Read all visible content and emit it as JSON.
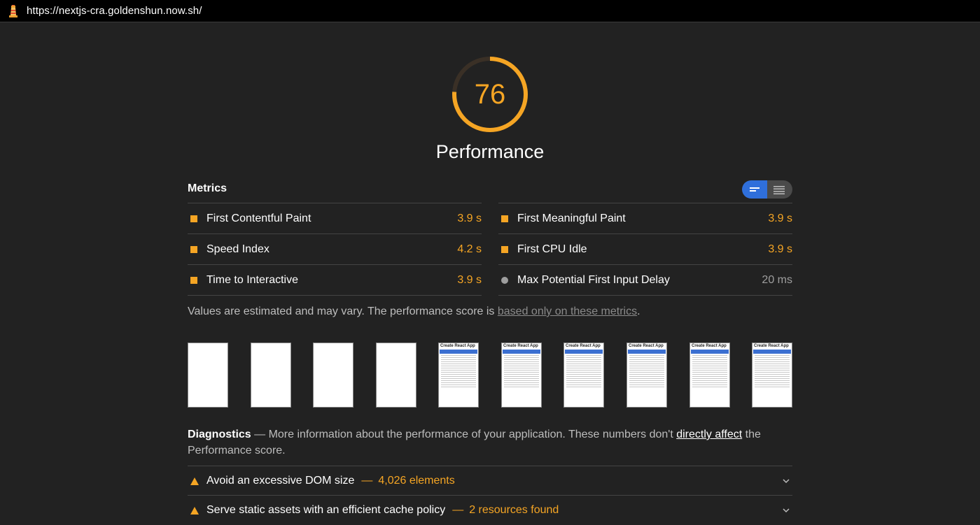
{
  "address_bar": {
    "url": "https://nextjs-cra.goldenshun.now.sh/"
  },
  "gauge": {
    "score": "76",
    "label": "Performance",
    "color": "#f5a524",
    "value": 0.76
  },
  "metrics": {
    "title": "Metrics",
    "left": [
      {
        "name": "First Contentful Paint",
        "value": "3.9 s"
      },
      {
        "name": "Speed Index",
        "value": "4.2 s"
      },
      {
        "name": "Time to Interactive",
        "value": "3.9 s"
      }
    ],
    "right": [
      {
        "name": "First Meaningful Paint",
        "value": "3.9 s"
      },
      {
        "name": "First CPU Idle",
        "value": "3.9 s"
      },
      {
        "name": "Max Potential First Input Delay",
        "value": "20 ms"
      }
    ]
  },
  "note": {
    "text": "Values are estimated and may vary. The performance score is ",
    "link": "based only on these metrics",
    "end": "."
  },
  "filmstrip": {
    "frame_title": "Create React App"
  },
  "diagnostics": {
    "title": "Diagnostics",
    "text": " — More information about the performance of your application. These numbers don't ",
    "link": "directly affect",
    "end": " the Performance score."
  },
  "audits": [
    {
      "title": "Avoid an excessive DOM size",
      "detail": "4,026 elements"
    },
    {
      "title": "Serve static assets with an efficient cache policy",
      "detail": "2 resources found"
    }
  ]
}
